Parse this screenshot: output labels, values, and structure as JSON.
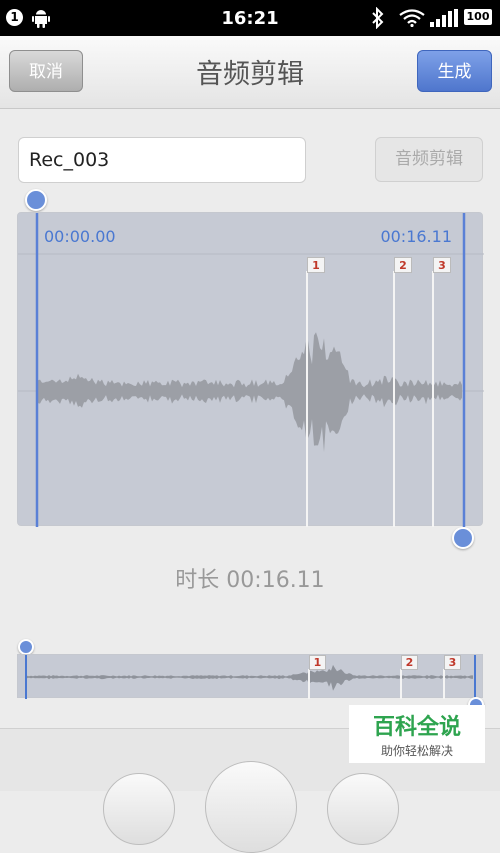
{
  "statusbar": {
    "notification_count": "1",
    "time": "16:21",
    "battery": "100",
    "icons": [
      "android-icon",
      "bluetooth-icon",
      "wifi-icon",
      "signal-icon",
      "battery-icon"
    ]
  },
  "header": {
    "cancel_label": "取消",
    "title": "音频剪辑",
    "generate_label": "生成"
  },
  "editor": {
    "filename": "Rec_003",
    "edit_button_label": "音频剪辑",
    "start_time": "00:00.00",
    "end_time": "00:16.11",
    "markers": [
      "1",
      "2",
      "3"
    ],
    "duration_text": "时长 00:16.11"
  },
  "mini": {
    "markers": [
      "1",
      "2",
      "3"
    ]
  },
  "watermark": {
    "title": "百科全说",
    "subtitle": "助你轻松解决"
  },
  "colors": {
    "accent": "#4a78d1",
    "wave_bg": "#c6cad4",
    "wave": "#999999",
    "marker_text": "#c0392b"
  }
}
